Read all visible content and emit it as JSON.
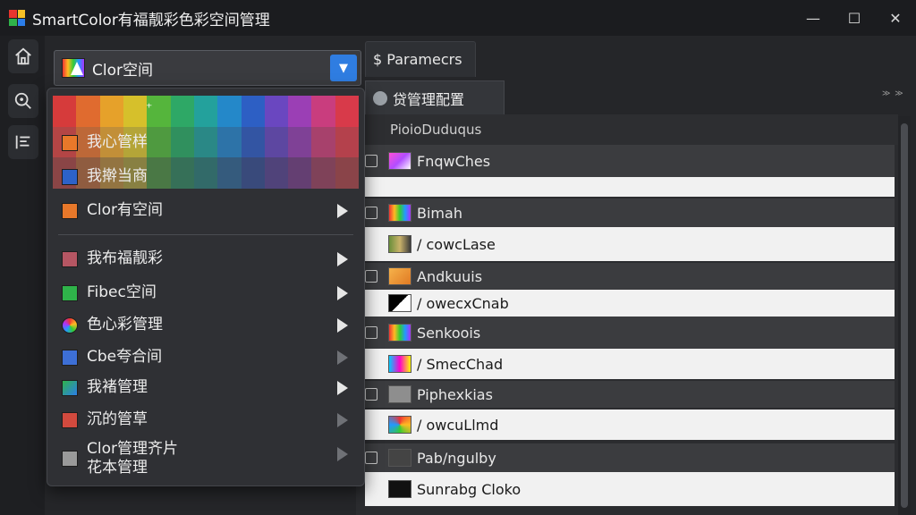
{
  "app": {
    "title": "SmartColor有福靓彩色彩空间管理",
    "logo_colors": [
      "#e8352e",
      "#f6c026",
      "#2fb34a",
      "#2b7de9"
    ]
  },
  "window_controls": {
    "minimize": "—",
    "maximize": "☐",
    "close": "✕"
  },
  "combo": {
    "value": "Clor空间",
    "accent": "#2f7de1"
  },
  "tabs": {
    "params": "$ Paramecrs",
    "config": "贷管理配置",
    "right_marker": "≫ ≫"
  },
  "list": {
    "column_header": "PioioDuduqus",
    "rows": [
      {
        "label": "FnqwChes",
        "style": "dark",
        "checkbox": true,
        "swatch": "pink-gradient"
      },
      {
        "label": "",
        "style": "light",
        "checkbox": false,
        "swatch": ""
      },
      {
        "label": "Bimah",
        "style": "dark",
        "checkbox": true,
        "swatch": "rainbow"
      },
      {
        "label": "/ cowcLase",
        "style": "light",
        "checkbox": false,
        "swatch": "photo"
      },
      {
        "label": "Andkuuis",
        "style": "dark",
        "checkbox": true,
        "swatch": "orange"
      },
      {
        "label": "/ owecxCnab",
        "style": "light",
        "checkbox": false,
        "swatch": "black-white"
      },
      {
        "label": "Senkoois",
        "style": "dark",
        "checkbox": true,
        "swatch": "rainbow"
      },
      {
        "label": "/ SmecChad",
        "style": "light",
        "checkbox": false,
        "swatch": "cmy"
      },
      {
        "label": "Piphexkias",
        "style": "dark",
        "checkbox": true,
        "swatch": "folder-gray"
      },
      {
        "label": "/ owcuLlmd",
        "style": "light",
        "checkbox": false,
        "swatch": "pinwheel"
      },
      {
        "label": "Pab/ngulby",
        "style": "dark",
        "checkbox": true,
        "swatch": "dark-gray"
      },
      {
        "label": "Sunrabg Cloko",
        "style": "light",
        "checkbox": false,
        "swatch": "black"
      }
    ]
  },
  "menu": {
    "spectrum_icon": "⁺",
    "items": [
      {
        "label": "我心管样",
        "swatch": "#e8782a",
        "arrow": "none"
      },
      {
        "label": "我擀当商",
        "swatch": "#2d62c9",
        "arrow": "none"
      },
      {
        "label": "Clor有空间",
        "swatch": "#e8782a",
        "arrow": "bright"
      },
      {
        "label": "我布福靓彩",
        "swatch": "#b65663",
        "arrow": "bright"
      },
      {
        "label": "Fibec空间",
        "swatch": "#2fb34a",
        "arrow": "bright"
      },
      {
        "label": "色心彩管理",
        "swatch": "radial",
        "arrow": "bright"
      },
      {
        "label": "Cbe夸合间",
        "swatch": "#3d6fd6",
        "arrow": "dim"
      },
      {
        "label": "我褚管理",
        "swatch": "mixed",
        "arrow": "bright"
      },
      {
        "label": "沉的管草",
        "swatch": "#d24a3e",
        "arrow": "dim"
      },
      {
        "label": "Clor管理齐片",
        "label2": "花本管理",
        "swatch": "#9a9a9a",
        "arrow": "dim"
      }
    ]
  }
}
